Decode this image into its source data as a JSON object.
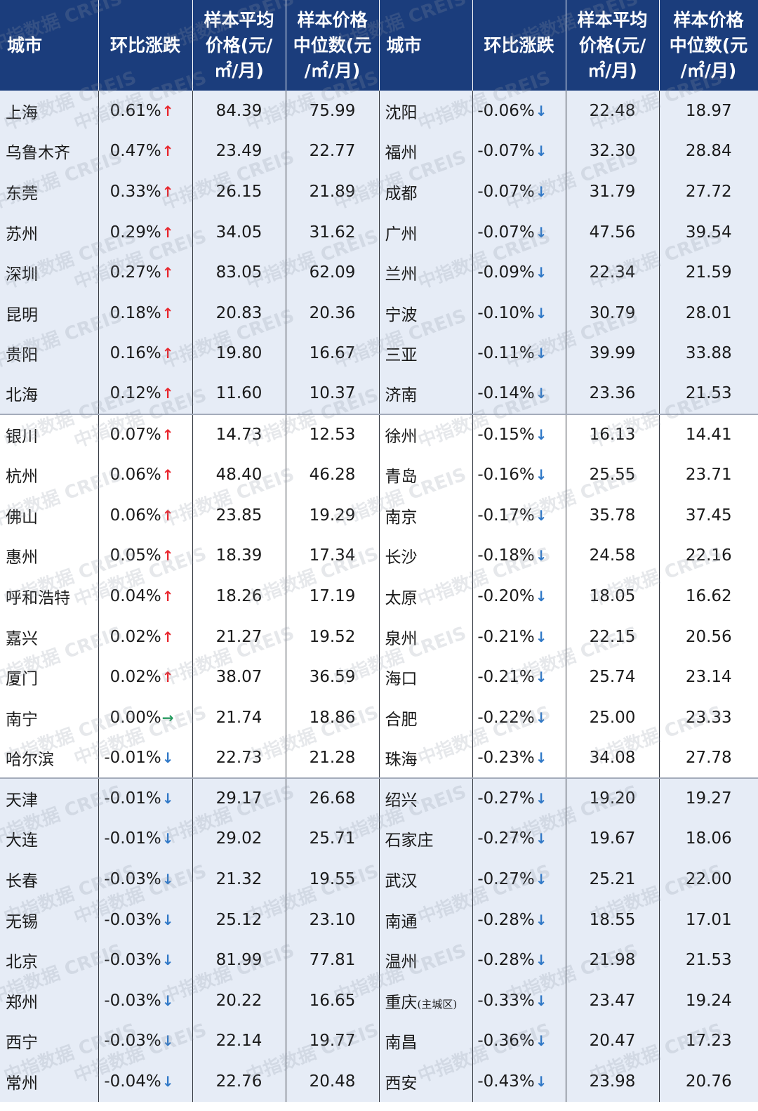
{
  "headers": {
    "city": "城市",
    "change": "环比涨跌",
    "avg": [
      "样本平均",
      "价格(元/",
      "㎡/月)"
    ],
    "median": [
      "样本价格",
      "中位数(元",
      "/㎡/月)"
    ]
  },
  "rows": [
    {
      "l": {
        "city": "上海",
        "change": "0.61%",
        "dir": "up",
        "avg": "84.39",
        "median": "75.99"
      },
      "r": {
        "city": "沈阳",
        "change": "-0.06%",
        "dir": "down",
        "avg": "22.48",
        "median": "18.97"
      }
    },
    {
      "l": {
        "city": "乌鲁木齐",
        "change": "0.47%",
        "dir": "up",
        "avg": "23.49",
        "median": "22.77"
      },
      "r": {
        "city": "福州",
        "change": "-0.07%",
        "dir": "down",
        "avg": "32.30",
        "median": "28.84"
      }
    },
    {
      "l": {
        "city": "东莞",
        "change": "0.33%",
        "dir": "up",
        "avg": "26.15",
        "median": "21.89"
      },
      "r": {
        "city": "成都",
        "change": "-0.07%",
        "dir": "down",
        "avg": "31.79",
        "median": "27.72"
      }
    },
    {
      "l": {
        "city": "苏州",
        "change": "0.29%",
        "dir": "up",
        "avg": "34.05",
        "median": "31.62"
      },
      "r": {
        "city": "广州",
        "change": "-0.07%",
        "dir": "down",
        "avg": "47.56",
        "median": "39.54"
      }
    },
    {
      "l": {
        "city": "深圳",
        "change": "0.27%",
        "dir": "up",
        "avg": "83.05",
        "median": "62.09"
      },
      "r": {
        "city": "兰州",
        "change": "-0.09%",
        "dir": "down",
        "avg": "22.34",
        "median": "21.59"
      }
    },
    {
      "l": {
        "city": "昆明",
        "change": "0.18%",
        "dir": "up",
        "avg": "20.83",
        "median": "20.36"
      },
      "r": {
        "city": "宁波",
        "change": "-0.10%",
        "dir": "down",
        "avg": "30.79",
        "median": "28.01"
      }
    },
    {
      "l": {
        "city": "贵阳",
        "change": "0.16%",
        "dir": "up",
        "avg": "19.80",
        "median": "16.67"
      },
      "r": {
        "city": "三亚",
        "change": "-0.11%",
        "dir": "down",
        "avg": "39.99",
        "median": "33.88"
      }
    },
    {
      "l": {
        "city": "北海",
        "change": "0.12%",
        "dir": "up",
        "avg": "11.60",
        "median": "10.37"
      },
      "r": {
        "city": "济南",
        "change": "-0.14%",
        "dir": "down",
        "avg": "23.36",
        "median": "21.53"
      }
    },
    {
      "l": {
        "city": "银川",
        "change": "0.07%",
        "dir": "up",
        "avg": "14.73",
        "median": "12.53"
      },
      "r": {
        "city": "徐州",
        "change": "-0.15%",
        "dir": "down",
        "avg": "16.13",
        "median": "14.41"
      }
    },
    {
      "l": {
        "city": "杭州",
        "change": "0.06%",
        "dir": "up",
        "avg": "48.40",
        "median": "46.28"
      },
      "r": {
        "city": "青岛",
        "change": "-0.16%",
        "dir": "down",
        "avg": "25.55",
        "median": "23.71"
      }
    },
    {
      "l": {
        "city": "佛山",
        "change": "0.06%",
        "dir": "up",
        "avg": "23.85",
        "median": "19.29"
      },
      "r": {
        "city": "南京",
        "change": "-0.17%",
        "dir": "down",
        "avg": "35.78",
        "median": "37.45"
      }
    },
    {
      "l": {
        "city": "惠州",
        "change": "0.05%",
        "dir": "up",
        "avg": "18.39",
        "median": "17.34"
      },
      "r": {
        "city": "长沙",
        "change": "-0.18%",
        "dir": "down",
        "avg": "24.58",
        "median": "22.16"
      }
    },
    {
      "l": {
        "city": "呼和浩特",
        "change": "0.04%",
        "dir": "up",
        "avg": "18.26",
        "median": "17.19"
      },
      "r": {
        "city": "太原",
        "change": "-0.20%",
        "dir": "down",
        "avg": "18.05",
        "median": "16.62"
      }
    },
    {
      "l": {
        "city": "嘉兴",
        "change": "0.02%",
        "dir": "up",
        "avg": "21.27",
        "median": "19.52"
      },
      "r": {
        "city": "泉州",
        "change": "-0.21%",
        "dir": "down",
        "avg": "22.15",
        "median": "20.56"
      }
    },
    {
      "l": {
        "city": "厦门",
        "change": "0.02%",
        "dir": "up",
        "avg": "38.07",
        "median": "36.59"
      },
      "r": {
        "city": "海口",
        "change": "-0.21%",
        "dir": "down",
        "avg": "25.74",
        "median": "23.14"
      }
    },
    {
      "l": {
        "city": "南宁",
        "change": "0.00%",
        "dir": "flat",
        "avg": "21.74",
        "median": "18.86"
      },
      "r": {
        "city": "合肥",
        "change": "-0.22%",
        "dir": "down",
        "avg": "25.00",
        "median": "23.33"
      }
    },
    {
      "l": {
        "city": "哈尔滨",
        "change": "-0.01%",
        "dir": "down",
        "avg": "22.73",
        "median": "21.28"
      },
      "r": {
        "city": "珠海",
        "change": "-0.23%",
        "dir": "down",
        "avg": "34.08",
        "median": "27.78"
      }
    },
    {
      "l": {
        "city": "天津",
        "change": "-0.01%",
        "dir": "down",
        "avg": "29.17",
        "median": "26.68"
      },
      "r": {
        "city": "绍兴",
        "change": "-0.27%",
        "dir": "down",
        "avg": "19.20",
        "median": "19.27"
      }
    },
    {
      "l": {
        "city": "大连",
        "change": "-0.01%",
        "dir": "down",
        "avg": "29.02",
        "median": "25.71"
      },
      "r": {
        "city": "石家庄",
        "change": "-0.27%",
        "dir": "down",
        "avg": "19.67",
        "median": "18.06"
      }
    },
    {
      "l": {
        "city": "长春",
        "change": "-0.03%",
        "dir": "down",
        "avg": "21.32",
        "median": "19.55"
      },
      "r": {
        "city": "武汉",
        "change": "-0.27%",
        "dir": "down",
        "avg": "25.21",
        "median": "22.00"
      }
    },
    {
      "l": {
        "city": "无锡",
        "change": "-0.03%",
        "dir": "down",
        "avg": "25.12",
        "median": "23.10"
      },
      "r": {
        "city": "南通",
        "change": "-0.28%",
        "dir": "down",
        "avg": "18.55",
        "median": "17.01"
      }
    },
    {
      "l": {
        "city": "北京",
        "change": "-0.03%",
        "dir": "down",
        "avg": "81.99",
        "median": "77.81"
      },
      "r": {
        "city": "温州",
        "change": "-0.28%",
        "dir": "down",
        "avg": "21.98",
        "median": "21.53"
      }
    },
    {
      "l": {
        "city": "郑州",
        "change": "-0.03%",
        "dir": "down",
        "avg": "20.22",
        "median": "16.65"
      },
      "r": {
        "city": "重庆",
        "city_note": "(主城区)",
        "change": "-0.33%",
        "dir": "down",
        "avg": "23.47",
        "median": "19.24"
      }
    },
    {
      "l": {
        "city": "西宁",
        "change": "-0.03%",
        "dir": "down",
        "avg": "22.14",
        "median": "19.77"
      },
      "r": {
        "city": "南昌",
        "change": "-0.36%",
        "dir": "down",
        "avg": "20.47",
        "median": "17.23"
      }
    },
    {
      "l": {
        "city": "常州",
        "change": "-0.04%",
        "dir": "down",
        "avg": "22.76",
        "median": "20.48"
      },
      "r": {
        "city": "西安",
        "change": "-0.43%",
        "dir": "down",
        "avg": "23.98",
        "median": "20.76"
      }
    }
  ],
  "arrows": {
    "up": "↑",
    "down": "↓",
    "flat": "→"
  },
  "watermark": "中指数据 CREIS",
  "colors": {
    "header_bg": "#1b3d7c",
    "band": "#e6ecf6",
    "up": "#e8262d",
    "down": "#2f78c7",
    "flat": "#1f9a5a"
  }
}
